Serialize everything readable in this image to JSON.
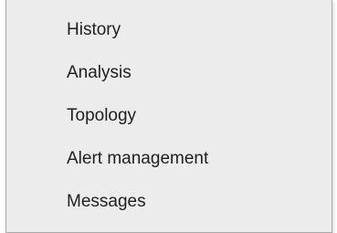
{
  "menu": {
    "items": [
      {
        "label": "History"
      },
      {
        "label": "Analysis"
      },
      {
        "label": "Topology"
      },
      {
        "label": "Alert management"
      },
      {
        "label": "Messages"
      }
    ]
  }
}
